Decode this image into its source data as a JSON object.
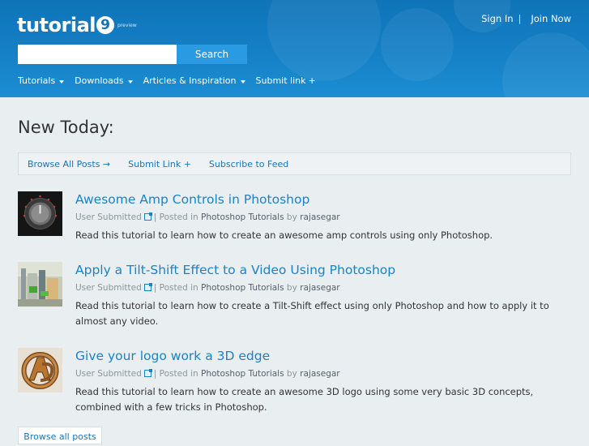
{
  "header": {
    "logo_text": "tutorial",
    "logo_nine": "9",
    "logo_badge": "preview",
    "sign_in": "Sign In",
    "separator": "|",
    "join_now": "Join Now",
    "search_button": "Search",
    "search_value": ""
  },
  "nav": [
    {
      "label": "Tutorials",
      "caret": true
    },
    {
      "label": "Downloads",
      "caret": true
    },
    {
      "label": "Articles & Inspiration",
      "caret": true
    },
    {
      "label": "Submit link",
      "plus": "+"
    }
  ],
  "main": {
    "title": "New Today:",
    "subnav": {
      "browse_all": "Browse All Posts →",
      "submit_link": "Submit Link +",
      "subscribe": "Subscribe to Feed"
    },
    "posts": [
      {
        "title": "Awesome Amp Controls in Photoshop",
        "submitted": "User Submitted",
        "posted_in_label": "| Posted in",
        "category": "Photoshop Tutorials",
        "by_label": "by",
        "author": "rajasegar",
        "description": "Read this tutorial to learn how to create an awesome amp controls using only Photoshop.",
        "thumb_icon": "amp-knob-thumbnail"
      },
      {
        "title": "Apply a Tilt-Shift Effect to a Video Using Photoshop",
        "submitted": "User Submitted",
        "posted_in_label": "| Posted in",
        "category": "Photoshop Tutorials",
        "by_label": "by",
        "author": "rajasegar",
        "description": "Read this tutorial to learn how to create a Tilt-Shift effect using only Photoshop and how to apply it to almost any video.",
        "thumb_icon": "tilt-shift-thumbnail"
      },
      {
        "title": "Give your logo work a 3D edge",
        "submitted": "User Submitted",
        "posted_in_label": "| Posted in",
        "category": "Photoshop Tutorials",
        "by_label": "by",
        "author": "rajasegar",
        "description": "Read this tutorial to learn how to create an awesome 3D logo using some very basic 3D concepts, combined with a few tricks in Photoshop.",
        "thumb_icon": "3d-logo-thumbnail"
      }
    ],
    "browse_all_button": "Browse all posts"
  },
  "colors": {
    "header_blue": "#1580c6",
    "link_blue": "#1a83c7",
    "search_button": "#2a9be3"
  }
}
